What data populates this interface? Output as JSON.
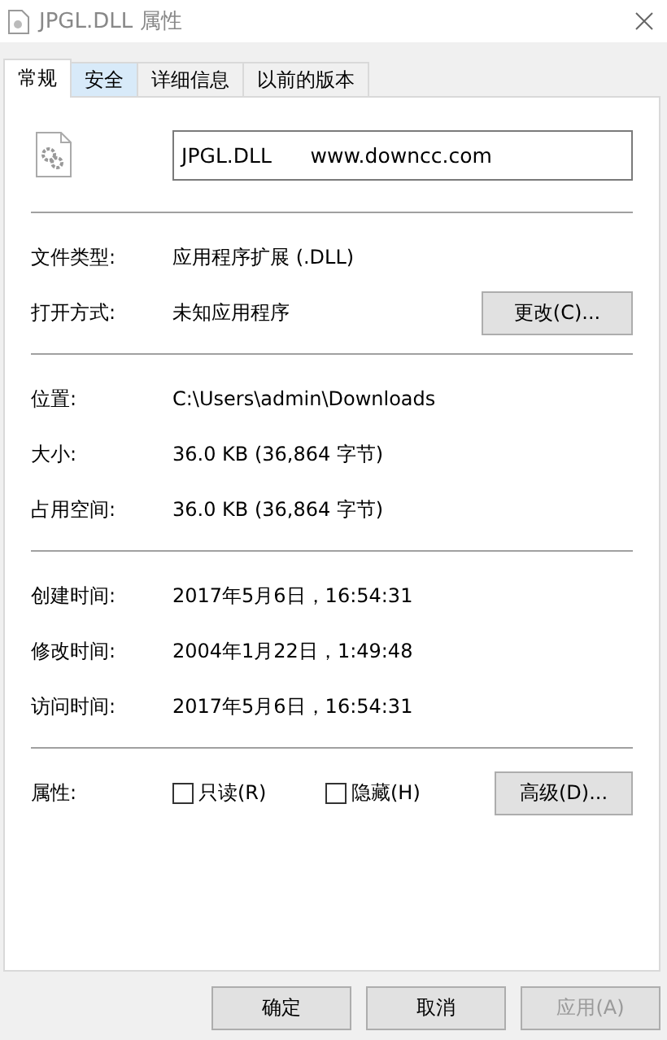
{
  "window": {
    "title": "JPGL.DLL 属性"
  },
  "tabs": [
    {
      "label": "常规",
      "selected": true,
      "hovered": false
    },
    {
      "label": "安全",
      "selected": false,
      "hovered": true
    },
    {
      "label": "详细信息",
      "selected": false,
      "hovered": false
    },
    {
      "label": "以前的版本",
      "selected": false,
      "hovered": false
    }
  ],
  "file_name": "JPGL.DLL      www.downcc.com",
  "sections": [
    {
      "rows": [
        {
          "label": "文件类型:",
          "value": "应用程序扩展 (.DLL)"
        },
        {
          "label": "打开方式:",
          "value": "未知应用程序",
          "button": "更改(C)..."
        }
      ]
    },
    {
      "rows": [
        {
          "label": "位置:",
          "value": "C:\\Users\\admin\\Downloads"
        },
        {
          "label": "大小:",
          "value": "36.0 KB (36,864 字节)"
        },
        {
          "label": "占用空间:",
          "value": "36.0 KB (36,864 字节)"
        }
      ]
    },
    {
      "rows": [
        {
          "label": "创建时间:",
          "value": "2017年5月6日，16:54:31"
        },
        {
          "label": "修改时间:",
          "value": "2004年1月22日，1:49:48"
        },
        {
          "label": "访问时间:",
          "value": "2017年5月6日，16:54:31"
        }
      ]
    }
  ],
  "attributes": {
    "label": "属性:",
    "checkboxes": [
      {
        "label": "只读(R)",
        "checked": false
      },
      {
        "label": "隐藏(H)",
        "checked": false
      }
    ],
    "button": "高级(D)..."
  },
  "buttons": [
    {
      "label": "确定",
      "disabled": false
    },
    {
      "label": "取消",
      "disabled": false
    },
    {
      "label": "应用(A)",
      "disabled": true
    }
  ]
}
